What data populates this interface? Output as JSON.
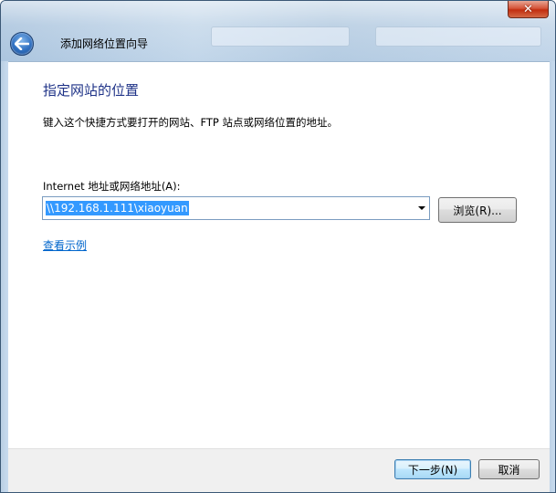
{
  "window": {
    "title": "添加网络位置向导",
    "close_glyph": "✕"
  },
  "page": {
    "heading": "指定网站的位置",
    "description": "键入这个快捷方式要打开的网站、FTP 站点或网络位置的地址。"
  },
  "address": {
    "label": "Internet 地址或网络地址(A):",
    "value": "\\\\192.168.1.111\\xiaoyuan",
    "browse_label": "浏览(R)..."
  },
  "links": {
    "example": "查看示例"
  },
  "footer": {
    "next_label": "下一步(N)",
    "cancel_label": "取消"
  },
  "icons": {
    "back": "back-arrow-icon",
    "close": "close-icon",
    "dropdown": "chevron-down-icon"
  },
  "colors": {
    "heading": "#1e3287",
    "link": "#0066cc",
    "selection": "#3399ff"
  }
}
